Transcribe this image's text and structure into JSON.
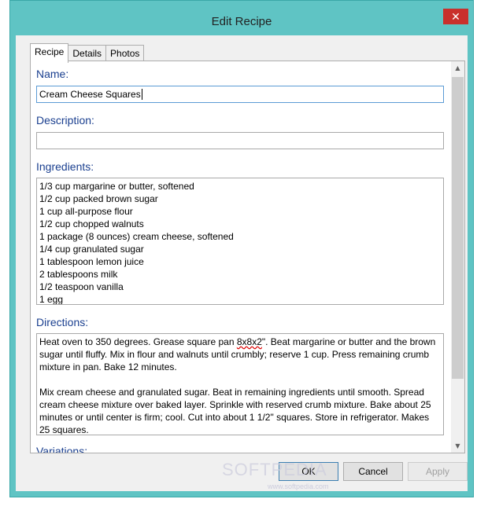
{
  "window": {
    "title": "Edit Recipe",
    "close_glyph": "✕"
  },
  "tabs": [
    {
      "label": "Recipe"
    },
    {
      "label": "Details"
    },
    {
      "label": "Photos"
    }
  ],
  "recipe": {
    "name_label": "Name:",
    "name_value": "Cream Cheese Squares",
    "description_label": "Description:",
    "description_value": "",
    "ingredients_label": "Ingredients:",
    "ingredients": [
      "1/3 cup margarine or butter, softened",
      "1/2 cup packed brown sugar",
      "1 cup all-purpose flour",
      "1/2 cup chopped walnuts",
      "1 package (8 ounces) cream cheese, softened",
      "1/4 cup granulated sugar",
      "1 tablespoon lemon juice",
      "2 tablespoons milk",
      "1/2 teaspoon vanilla",
      "1 egg"
    ],
    "directions_label": "Directions:",
    "directions": {
      "p1_a": "Heat oven to 350 degrees. Grease square pan ",
      "p1_b": "8x8x2",
      "p1_c": "\". Beat margarine or butter and the brown sugar until fluffy. Mix in flour and walnuts until crumbly; reserve 1 cup. Press remaining crumb mixture in pan. Bake 12 minutes.",
      "p2": "Mix cream cheese and granulated sugar. Beat in remaining ingredients until smooth. Spread cream cheese mixture over baked layer. Sprinkle with reserved crumb mixture. Bake about 25 minutes or until center is firm; cool. Cut into about 1 1/2\" squares. Store in refrigerator. Makes 25 squares."
    },
    "variations_label": "Variations:"
  },
  "buttons": {
    "ok": "OK",
    "cancel": "Cancel",
    "apply": "Apply"
  },
  "watermark": {
    "brand": "SOFTPEDIA",
    "url": "www.softpedia.com"
  }
}
